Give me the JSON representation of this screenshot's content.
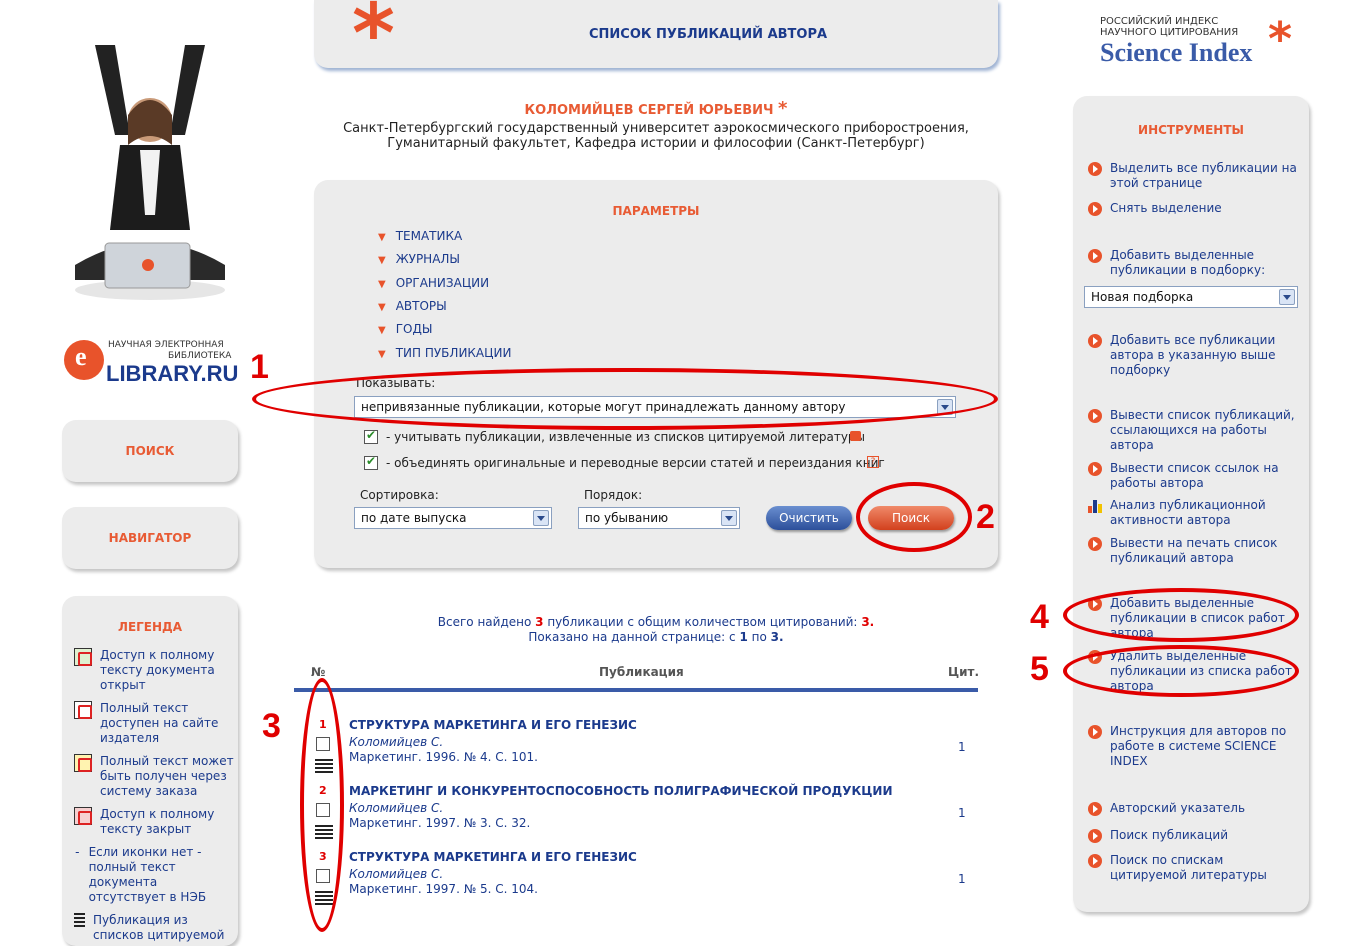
{
  "header": {
    "title": "СПИСОК ПУБЛИКАЦИЙ АВТОРА"
  },
  "brand": {
    "science_index_line1": "РОССИЙСКИЙ ИНДЕКС",
    "science_index_line2": "НАУЧНОГО ЦИТИРОВАНИЯ",
    "science_index_name": "Science Index",
    "elib_line1": "НАУЧНАЯ ЭЛЕКТРОННАЯ",
    "elib_line2": "БИБЛИОТЕКА",
    "elib_name": "LIBRARY.RU",
    "elib_letter": "e"
  },
  "author": {
    "name": "КОЛОМИЙЦЕВ СЕРГЕЙ ЮРЬЕВИЧ",
    "affil_line1": "Санкт-Петербургский государственный университет аэрокосмического приборостроения,",
    "affil_line2": "Гуманитарный факультет, Кафедра истории и философии (Санкт-Петербург)"
  },
  "left_nav": {
    "search": "ПОИСК",
    "navigator": "НАВИГАТОР"
  },
  "legend": {
    "title": "ЛЕГЕНДА",
    "items": [
      "Доступ к полному тексту документа открыт",
      "Полный текст доступен на сайте издателя",
      "Полный текст может быть получен через систему заказа",
      "Доступ к полному тексту закрыт",
      "Если иконки нет - полный текст документа отсутствует в НЭБ",
      "Публикация из списков цитируемой"
    ],
    "dash": "-"
  },
  "params": {
    "title": "ПАРАМЕТРЫ",
    "items": [
      "ТЕМАТИКА",
      "ЖУРНАЛЫ",
      "ОРГАНИЗАЦИИ",
      "АВТОРЫ",
      "ГОДЫ",
      "ТИП ПУБЛИКАЦИИ"
    ],
    "show_label": "Показывать:",
    "show_value": "непривязанные публикации, которые могут принадлежать данному автору",
    "chk1": "- учитывать публикации, извлеченные из списков цитируемой литературы",
    "chk2": "- объединять оригинальные и переводные версии статей и переиздания книг",
    "sort_label": "Сортировка:",
    "sort_value": "по дате выпуска",
    "order_label": "Порядок:",
    "order_value": "по убыванию",
    "clear_btn": "Очистить",
    "search_btn": "Поиск",
    "help": "?"
  },
  "results": {
    "found_prefix": "Всего найдено",
    "found_count": "3",
    "found_middle": "публикации с общим количеством цитирований:",
    "cite_total": "3.",
    "shown_prefix": "Показано на данной странице: с",
    "shown_from": "1",
    "shown_mid": "по",
    "shown_to": "3.",
    "col_num": "№",
    "col_pub": "Публикация",
    "col_cit": "Цит.",
    "rows": [
      {
        "num": "1",
        "title": "СТРУКТУРА МАРКЕТИНГА И ЕГО ГЕНЕЗИС",
        "author": "Коломийцев С.",
        "source": "Маркетинг. 1996. № 4. С. 101.",
        "cit": "1"
      },
      {
        "num": "2",
        "title": "МАРКЕТИНГ И КОНКУРЕНТОСПОСОБНОСТЬ ПОЛИГРАФИЧЕСКОЙ ПРОДУКЦИИ",
        "author": "Коломийцев С.",
        "source": "Маркетинг. 1997. № 3. С. 32.",
        "cit": "1"
      },
      {
        "num": "3",
        "title": "СТРУКТУРА МАРКЕТИНГА И ЕГО ГЕНЕЗИС",
        "author": "Коломийцев С.",
        "source": "Маркетинг. 1997. № 5. С. 104.",
        "cit": "1"
      }
    ]
  },
  "tools": {
    "title": "ИНСТРУМЕНТЫ",
    "select_all": "Выделить все публикации на этой странице",
    "deselect": "Снять выделение",
    "add_selected": "Добавить выделенные публикации в подборку:",
    "collection_value": "Новая подборка",
    "add_all": "Добавить все публикации автора в указанную выше подборку",
    "list_citing": "Вывести список публикаций, ссылающихся на работы автора",
    "list_refs": "Вывести список ссылок на работы автора",
    "analysis": "Анализ публикационной активности автора",
    "print": "Вывести на печать список публикаций автора",
    "add_to_list": "Добавить выделенные публикации в список работ автора",
    "remove_from_list": "Удалить выделенные публикации из списка работ автора",
    "instruction": "Инструкция для авторов по работе в системе SCIENCE INDEX",
    "author_index": "Авторский указатель",
    "pub_search": "Поиск публикаций",
    "ref_search": "Поиск по спискам цитируемой литературы"
  },
  "annotations": [
    "1",
    "2",
    "3",
    "4",
    "5"
  ],
  "colors": {
    "accent": "#e8532b",
    "link": "#1b3a8c",
    "annotation": "#e00000",
    "panel": "#ececec"
  }
}
